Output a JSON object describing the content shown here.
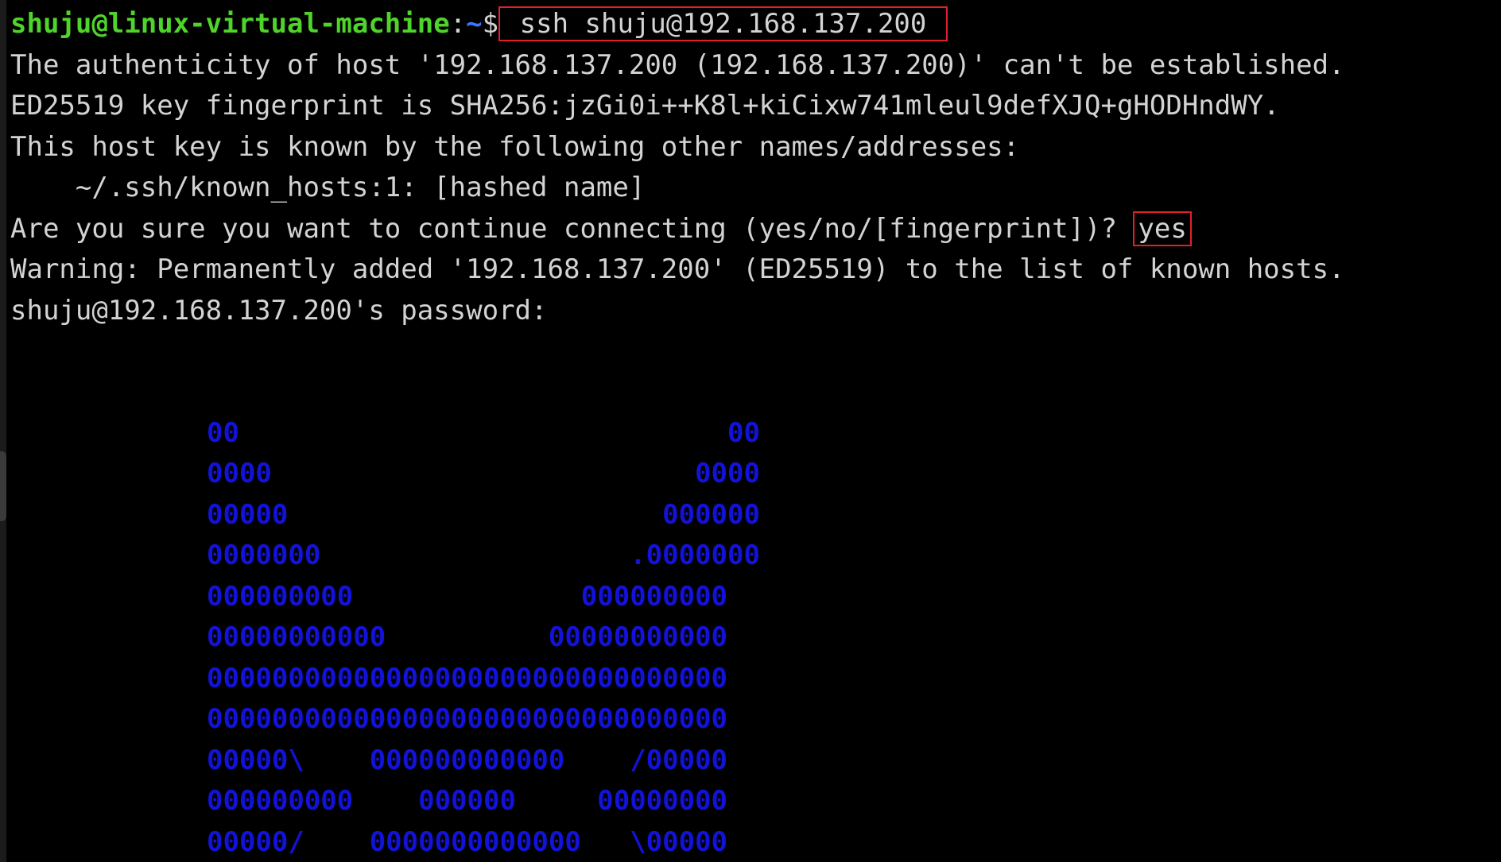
{
  "prompt": {
    "user_host": "shuju@linux-virtual-machine",
    "colon": ":",
    "path": "~",
    "dollar": "$",
    "command": "ssh shuju@192.168.137.200"
  },
  "output": [
    "The authenticity of host '192.168.137.200 (192.168.137.200)' can't be established.",
    "ED25519 key fingerprint is SHA256:jzGi0i++K8l+kiCixw741mleul9defXJQ+gHODHndWY.",
    "This host key is known by the following other names/addresses:",
    "    ~/.ssh/known_hosts:1: [hashed name]"
  ],
  "confirm": {
    "question": "Are you sure you want to continue connecting (yes/no/[fingerprint])? ",
    "answer": "yes"
  },
  "warning": "Warning: Permanently added '192.168.137.200' (ED25519) to the list of known hosts.",
  "password_prompt": "shuju@192.168.137.200's password:",
  "banner": [
    "00                              00",
    "0000                          0000",
    "00000                       000000",
    "0000000                   .0000000",
    "000000000              000000000",
    "00000000000          00000000000",
    "00000000000000000000000000000000",
    "00000000000000000000000000000000",
    "00000\\    000000000000    /00000",
    "000000000    000000     00000000",
    "00000/    0000000000000   \\00000"
  ],
  "colors": {
    "background": "#000000",
    "text": "#d3d3d3",
    "prompt_user": "#4ed42b",
    "prompt_path": "#3b78ff",
    "banner": "#1212d8",
    "highlight_box": "#e0202a"
  }
}
